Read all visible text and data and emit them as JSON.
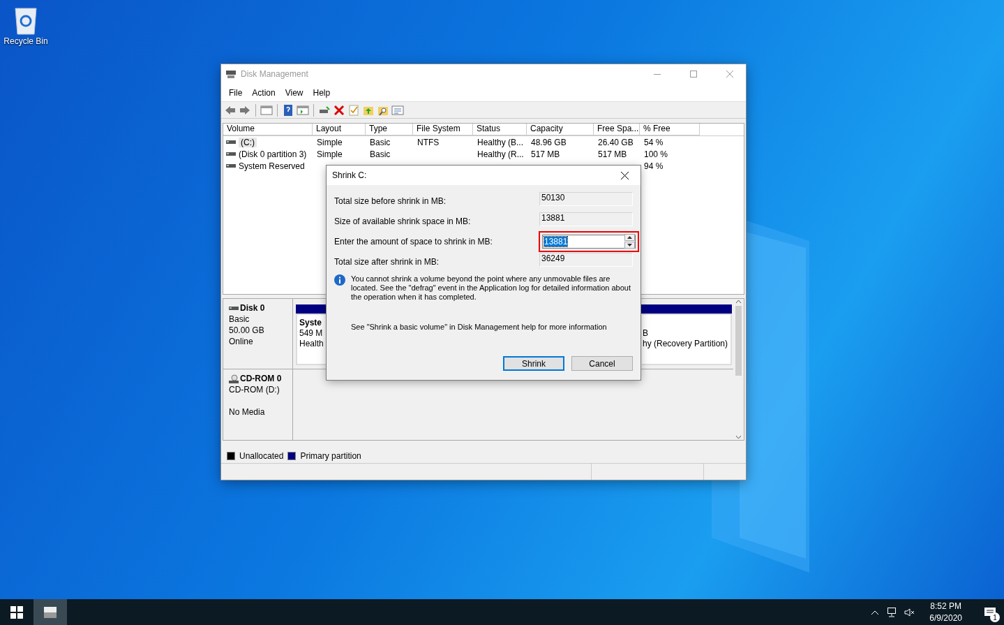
{
  "desktop_icons": [
    {
      "label": "Recycle Bin"
    }
  ],
  "window": {
    "title": "Disk Management",
    "menu": [
      "File",
      "Action",
      "View",
      "Help"
    ],
    "volume_table": {
      "columns": [
        "Volume",
        "Layout",
        "Type",
        "File System",
        "Status",
        "Capacity",
        "Free Spa...",
        "% Free"
      ],
      "rows": [
        {
          "selected": true,
          "cells": [
            "(C:)",
            "Simple",
            "Basic",
            "NTFS",
            "Healthy (B...",
            "48.96 GB",
            "26.40 GB",
            "54 %"
          ]
        },
        {
          "selected": false,
          "cells": [
            "(Disk 0 partition 3)",
            "Simple",
            "Basic",
            "",
            "Healthy (R...",
            "517 MB",
            "517 MB",
            "100 %"
          ]
        },
        {
          "selected": false,
          "cells": [
            "System Reserved",
            "",
            "",
            "",
            "",
            "",
            "",
            "94 %"
          ]
        }
      ]
    },
    "disks": [
      {
        "kind": "disk",
        "name": "Disk 0",
        "type": "Basic",
        "size": "50.00 GB",
        "status": "Online",
        "partitions": [
          {
            "name": "Syste",
            "size": "549 M",
            "status": "Health"
          },
          {
            "size": "B",
            "status": "hy (Recovery Partition)"
          }
        ]
      },
      {
        "kind": "cdrom",
        "name": "CD-ROM 0",
        "type": "CD-ROM (D:)",
        "status": "No Media"
      }
    ],
    "legend": [
      {
        "label": "Unallocated",
        "color": "#000000"
      },
      {
        "label": "Primary partition",
        "color": "#000080"
      }
    ]
  },
  "dialog": {
    "title": "Shrink C:",
    "fields": [
      {
        "kind": "readonly",
        "label": "Total size before shrink in MB:",
        "value": "50130"
      },
      {
        "kind": "readonly",
        "label": "Size of available shrink space in MB:",
        "value": "13881"
      },
      {
        "kind": "spinner",
        "label": "Enter the amount of space to shrink in MB:",
        "value": "13881",
        "highlighted": true,
        "text_selected": true
      },
      {
        "kind": "readonly",
        "label": "Total size after shrink in MB:",
        "value": "36249"
      }
    ],
    "info": "You cannot shrink a volume beyond the point where any unmovable files are located. See the \"defrag\" event in the Application log for detailed information about the operation when it has completed.",
    "help": "See \"Shrink a basic volume\" in Disk Management help for more information",
    "buttons": [
      {
        "label": "Shrink",
        "default": true
      },
      {
        "label": "Cancel",
        "default": false
      }
    ]
  },
  "taskbar": {
    "time": "8:52 PM",
    "date": "6/9/2020",
    "notification_count": "1"
  }
}
